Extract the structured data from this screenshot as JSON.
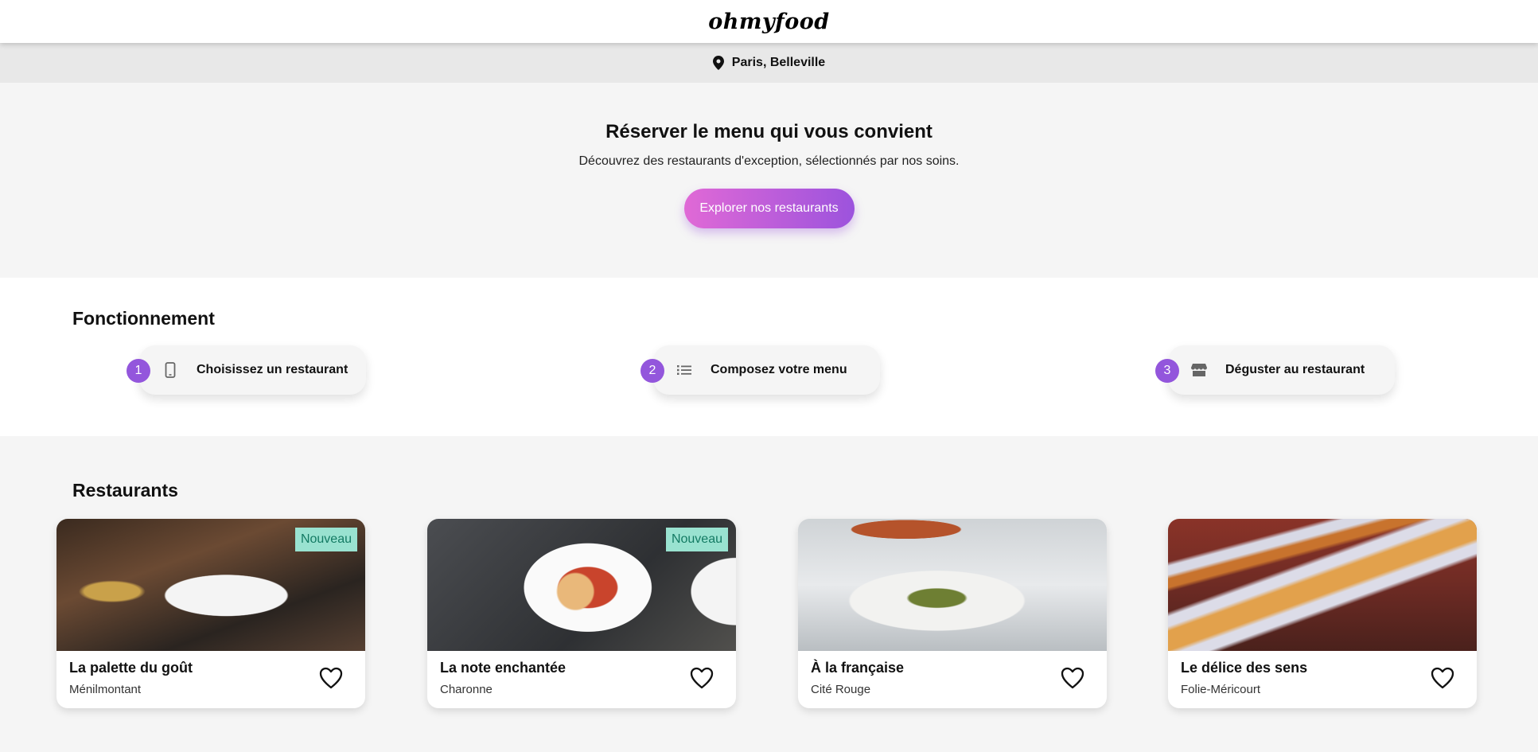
{
  "header": {
    "logo": "ohmyfood"
  },
  "location": {
    "icon": "map-pin-icon",
    "text": "Paris, Belleville"
  },
  "hero": {
    "title": "Réserver le menu qui vous convient",
    "subtitle": "Découvrez des restaurants d'exception, sélectionnés par nos soins.",
    "button_label": "Explorer nos restaurants",
    "button_gradient": [
      "#e069d6",
      "#9c53dd"
    ]
  },
  "how_it_works": {
    "title": "Fonctionnement",
    "steps": [
      {
        "number": "1",
        "icon": "smartphone-icon",
        "label": "Choisissez un restaurant"
      },
      {
        "number": "2",
        "icon": "list-icon",
        "label": "Composez votre menu"
      },
      {
        "number": "3",
        "icon": "store-icon",
        "label": "Déguster au restaurant"
      }
    ],
    "accent_color": "#9356dc"
  },
  "restaurants": {
    "title": "Restaurants",
    "cards": [
      {
        "name": "La palette du goût",
        "area": "Ménilmontant",
        "badge": "Nouveau",
        "icon": "heart-outline-icon"
      },
      {
        "name": "La note enchantée",
        "area": "Charonne",
        "badge": "Nouveau",
        "icon": "heart-outline-icon"
      },
      {
        "name": "À la française",
        "area": "Cité Rouge",
        "badge": "",
        "icon": "heart-outline-icon"
      },
      {
        "name": "Le délice des sens",
        "area": "Folie-Méricourt",
        "badge": "",
        "icon": "heart-outline-icon"
      }
    ],
    "badge_color": "#99e2d0"
  }
}
